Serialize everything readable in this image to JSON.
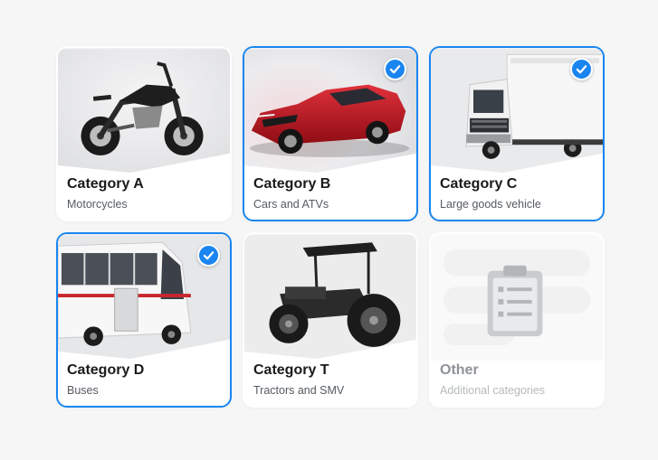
{
  "categories": [
    {
      "id": "A",
      "title": "Category A",
      "subtitle": "Motorcycles",
      "selected": false,
      "disabled": false,
      "icon": "motorcycle-image"
    },
    {
      "id": "B",
      "title": "Category B",
      "subtitle": "Cars and ATVs",
      "selected": true,
      "disabled": false,
      "icon": "car-image"
    },
    {
      "id": "C",
      "title": "Category C",
      "subtitle": "Large goods vehicle",
      "selected": true,
      "disabled": false,
      "icon": "truck-image"
    },
    {
      "id": "D",
      "title": "Category D",
      "subtitle": "Buses",
      "selected": true,
      "disabled": false,
      "icon": "bus-image"
    },
    {
      "id": "T",
      "title": "Category T",
      "subtitle": "Tractors and SMV",
      "selected": false,
      "disabled": false,
      "icon": "tractor-image"
    },
    {
      "id": "Other",
      "title": "Other",
      "subtitle": "Additional categories",
      "selected": false,
      "disabled": true,
      "icon": "clipboard-list-icon"
    }
  ],
  "colors": {
    "accent": "#1a85f0",
    "background": "#f6f6f7",
    "card": "#ffffff"
  }
}
